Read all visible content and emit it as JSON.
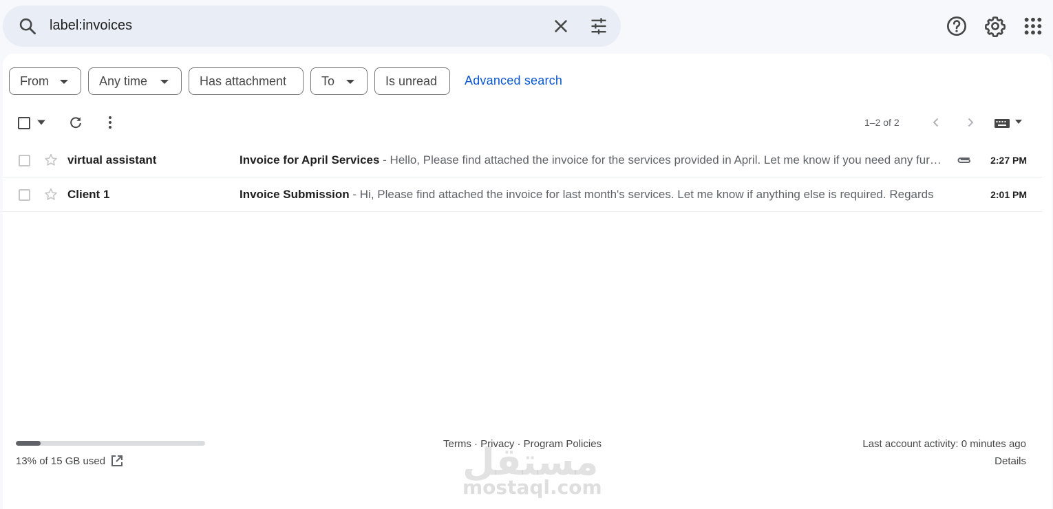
{
  "search": {
    "query": "label:invoices",
    "clear_icon": "close-icon",
    "options_icon": "tune-icon"
  },
  "header_icons": [
    "help-icon",
    "settings-gear-icon",
    "apps-grid-icon"
  ],
  "filters": {
    "from": "From",
    "any_time": "Any time",
    "has_attachment": "Has attachment",
    "to": "To",
    "is_unread": "Is unread",
    "advanced_search": "Advanced search"
  },
  "toolbar": {
    "range": "1–2 of 2"
  },
  "emails": [
    {
      "sender": "virtual assistant",
      "subject": "Invoice for April Services",
      "snippet": " - Hello, Please find attached the invoice for the services provided in April. Let me know if you need any further information.",
      "has_attachment": true,
      "time": "2:27 PM"
    },
    {
      "sender": "Client 1",
      "subject": "Invoice Submission",
      "snippet": " - Hi, Please find attached the invoice for last month's services. Let me know if anything else is required. Regards",
      "has_attachment": false,
      "time": "2:01 PM"
    }
  ],
  "footer": {
    "storage_text": "13% of 15 GB used",
    "storage_fraction": 0.13,
    "links": "Terms · Privacy · Program Policies",
    "last_activity": "Last account activity: 0 minutes ago",
    "details": "Details"
  },
  "watermark": {
    "arabic": "مستقل",
    "latin": "mostaql.com"
  },
  "colors": {
    "accent_link": "#0b57d0",
    "background": "#f6f8fc",
    "search_bg": "#e9eef6"
  }
}
